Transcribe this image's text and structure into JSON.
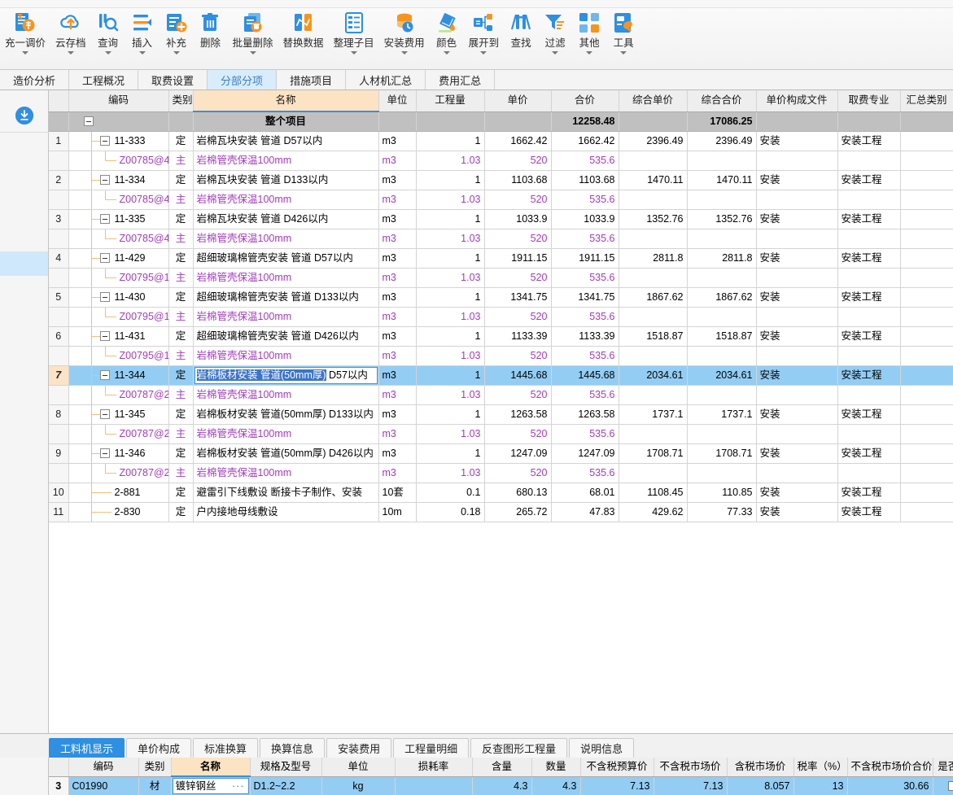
{
  "toolbar": {
    "items": [
      {
        "label": "充一调价",
        "icon": "price-adjust-icon",
        "caret": true
      },
      {
        "label": "云存档",
        "icon": "cloud-upload-icon",
        "caret": true
      },
      {
        "label": "查询",
        "icon": "query-search-icon",
        "caret": true
      },
      {
        "label": "插入",
        "icon": "insert-row-icon",
        "caret": true
      },
      {
        "label": "补充",
        "icon": "supplement-add-icon",
        "caret": true
      },
      {
        "label": "删除",
        "icon": "trash-delete-icon",
        "caret": false
      },
      {
        "label": "批量删除",
        "icon": "batch-delete-icon",
        "caret": true
      },
      {
        "label": "替换数据",
        "icon": "replace-data-icon",
        "caret": false
      },
      {
        "label": "整理子目",
        "icon": "organize-items-icon",
        "caret": true
      },
      {
        "label": "安装费用",
        "icon": "install-fee-icon",
        "caret": true
      },
      {
        "label": "颜色",
        "icon": "color-fill-icon",
        "caret": true
      },
      {
        "label": "展开到",
        "icon": "expand-to-icon",
        "caret": true
      },
      {
        "label": "查找",
        "icon": "find-binocular-icon",
        "caret": false
      },
      {
        "label": "过滤",
        "icon": "filter-funnel-icon",
        "caret": true
      },
      {
        "label": "其他",
        "icon": "other-grid-icon",
        "caret": true
      },
      {
        "label": "工具",
        "icon": "tools-icon",
        "caret": true
      }
    ]
  },
  "main_tabs": [
    {
      "label": "造价分析",
      "active": false
    },
    {
      "label": "工程概况",
      "active": false
    },
    {
      "label": "取费设置",
      "active": false
    },
    {
      "label": "分部分项",
      "active": true
    },
    {
      "label": "措施项目",
      "active": false
    },
    {
      "label": "人材机汇总",
      "active": false
    },
    {
      "label": "费用汇总",
      "active": false
    }
  ],
  "grid": {
    "headers": [
      "",
      "编码",
      "类别",
      "名称",
      "单位",
      "工程量",
      "单价",
      "合价",
      "综合单价",
      "综合合价",
      "单价构成文件",
      "取费专业",
      "汇总类别"
    ],
    "total_row": {
      "name": "整个项目",
      "heji": "12258.48",
      "zonghe_heji": "17086.25"
    },
    "rows": [
      {
        "no": "1",
        "code": "11-333",
        "kind": "定",
        "name": "岩棉瓦块安装  管道 D57以内",
        "unit": "m3",
        "qty": "1",
        "price": "1662.42",
        "amount": "1662.42",
        "zh_price": "2396.49",
        "zh_amount": "2396.49",
        "file": "安装",
        "prof": "安装工程",
        "cat": "",
        "type": "parent"
      },
      {
        "no": "",
        "code": "Z00785@4",
        "kind": "主",
        "name": "岩棉管壳保温100mm",
        "unit": "m3",
        "qty": "1.03",
        "price": "520",
        "amount": "535.6",
        "zh_price": "",
        "zh_amount": "",
        "file": "",
        "prof": "",
        "cat": "",
        "type": "child"
      },
      {
        "no": "2",
        "code": "11-334",
        "kind": "定",
        "name": "岩棉瓦块安装  管道 D133以内",
        "unit": "m3",
        "qty": "1",
        "price": "1103.68",
        "amount": "1103.68",
        "zh_price": "1470.11",
        "zh_amount": "1470.11",
        "file": "安装",
        "prof": "安装工程",
        "cat": "",
        "type": "parent"
      },
      {
        "no": "",
        "code": "Z00785@4",
        "kind": "主",
        "name": "岩棉管壳保温100mm",
        "unit": "m3",
        "qty": "1.03",
        "price": "520",
        "amount": "535.6",
        "zh_price": "",
        "zh_amount": "",
        "file": "",
        "prof": "",
        "cat": "",
        "type": "child"
      },
      {
        "no": "3",
        "code": "11-335",
        "kind": "定",
        "name": "岩棉瓦块安装  管道 D426以内",
        "unit": "m3",
        "qty": "1",
        "price": "1033.9",
        "amount": "1033.9",
        "zh_price": "1352.76",
        "zh_amount": "1352.76",
        "file": "安装",
        "prof": "安装工程",
        "cat": "",
        "type": "parent"
      },
      {
        "no": "",
        "code": "Z00785@4",
        "kind": "主",
        "name": "岩棉管壳保温100mm",
        "unit": "m3",
        "qty": "1.03",
        "price": "520",
        "amount": "535.6",
        "zh_price": "",
        "zh_amount": "",
        "file": "",
        "prof": "",
        "cat": "",
        "type": "child"
      },
      {
        "no": "4",
        "code": "11-429",
        "kind": "定",
        "name": "超细玻璃棉管壳安装  管道 D57以内",
        "unit": "m3",
        "qty": "1",
        "price": "1911.15",
        "amount": "1911.15",
        "zh_price": "2811.8",
        "zh_amount": "2811.8",
        "file": "安装",
        "prof": "安装工程",
        "cat": "",
        "type": "parent"
      },
      {
        "no": "",
        "code": "Z00795@1",
        "kind": "主",
        "name": "岩棉管壳保温100mm",
        "unit": "m3",
        "qty": "1.03",
        "price": "520",
        "amount": "535.6",
        "zh_price": "",
        "zh_amount": "",
        "file": "",
        "prof": "",
        "cat": "",
        "type": "child"
      },
      {
        "no": "5",
        "code": "11-430",
        "kind": "定",
        "name": "超细玻璃棉管壳安装  管道 D133以内",
        "unit": "m3",
        "qty": "1",
        "price": "1341.75",
        "amount": "1341.75",
        "zh_price": "1867.62",
        "zh_amount": "1867.62",
        "file": "安装",
        "prof": "安装工程",
        "cat": "",
        "type": "parent"
      },
      {
        "no": "",
        "code": "Z00795@1",
        "kind": "主",
        "name": "岩棉管壳保温100mm",
        "unit": "m3",
        "qty": "1.03",
        "price": "520",
        "amount": "535.6",
        "zh_price": "",
        "zh_amount": "",
        "file": "",
        "prof": "",
        "cat": "",
        "type": "child"
      },
      {
        "no": "6",
        "code": "11-431",
        "kind": "定",
        "name": "超细玻璃棉管壳安装  管道 D426以内",
        "unit": "m3",
        "qty": "1",
        "price": "1133.39",
        "amount": "1133.39",
        "zh_price": "1518.87",
        "zh_amount": "1518.87",
        "file": "安装",
        "prof": "安装工程",
        "cat": "",
        "type": "parent"
      },
      {
        "no": "",
        "code": "Z00795@1",
        "kind": "主",
        "name": "岩棉管壳保温100mm",
        "unit": "m3",
        "qty": "1.03",
        "price": "520",
        "amount": "535.6",
        "zh_price": "",
        "zh_amount": "",
        "file": "",
        "prof": "",
        "cat": "",
        "type": "child"
      },
      {
        "no": "7",
        "code": "11-344",
        "kind": "定",
        "name": "岩棉板材安装  管道(50mm厚) D57以内",
        "name_selected": "岩棉板材安装  管道(50mm厚)",
        "name_rest": " D57以内",
        "unit": "m3",
        "qty": "1",
        "price": "1445.68",
        "amount": "1445.68",
        "zh_price": "2034.61",
        "zh_amount": "2034.61",
        "file": "安装",
        "prof": "安装工程",
        "cat": "",
        "type": "parent",
        "selected": true,
        "editing": true
      },
      {
        "no": "",
        "code": "Z00787@2",
        "kind": "主",
        "name": "岩棉管壳保温100mm",
        "unit": "m3",
        "qty": "1.03",
        "price": "520",
        "amount": "535.6",
        "zh_price": "",
        "zh_amount": "",
        "file": "",
        "prof": "",
        "cat": "",
        "type": "child"
      },
      {
        "no": "8",
        "code": "11-345",
        "kind": "定",
        "name": "岩棉板材安装  管道(50mm厚) D133以内",
        "unit": "m3",
        "qty": "1",
        "price": "1263.58",
        "amount": "1263.58",
        "zh_price": "1737.1",
        "zh_amount": "1737.1",
        "file": "安装",
        "prof": "安装工程",
        "cat": "",
        "type": "parent"
      },
      {
        "no": "",
        "code": "Z00787@2",
        "kind": "主",
        "name": "岩棉管壳保温100mm",
        "unit": "m3",
        "qty": "1.03",
        "price": "520",
        "amount": "535.6",
        "zh_price": "",
        "zh_amount": "",
        "file": "",
        "prof": "",
        "cat": "",
        "type": "child"
      },
      {
        "no": "9",
        "code": "11-346",
        "kind": "定",
        "name": "岩棉板材安装  管道(50mm厚) D426以内",
        "unit": "m3",
        "qty": "1",
        "price": "1247.09",
        "amount": "1247.09",
        "zh_price": "1708.71",
        "zh_amount": "1708.71",
        "file": "安装",
        "prof": "安装工程",
        "cat": "",
        "type": "parent"
      },
      {
        "no": "",
        "code": "Z00787@2",
        "kind": "主",
        "name": "岩棉管壳保温100mm",
        "unit": "m3",
        "qty": "1.03",
        "price": "520",
        "amount": "535.6",
        "zh_price": "",
        "zh_amount": "",
        "file": "",
        "prof": "",
        "cat": "",
        "type": "child"
      },
      {
        "no": "10",
        "code": "2-881",
        "kind": "定",
        "name": "避雷引下线敷设  断接卡子制作、安装",
        "unit": "10套",
        "qty": "0.1",
        "price": "680.13",
        "amount": "68.01",
        "zh_price": "1108.45",
        "zh_amount": "110.85",
        "file": "安装",
        "prof": "安装工程",
        "cat": "",
        "type": "leaf"
      },
      {
        "no": "11",
        "code": "2-830",
        "kind": "定",
        "name": "户内接地母线敷设",
        "unit": "10m",
        "qty": "0.18",
        "price": "265.72",
        "amount": "47.83",
        "zh_price": "429.62",
        "zh_amount": "77.33",
        "file": "安装",
        "prof": "安装工程",
        "cat": "",
        "type": "leaf"
      }
    ]
  },
  "bottom": {
    "tabs": [
      {
        "label": "工料机显示",
        "active": true
      },
      {
        "label": "单价构成",
        "active": false
      },
      {
        "label": "标准换算",
        "active": false
      },
      {
        "label": "换算信息",
        "active": false
      },
      {
        "label": "安装费用",
        "active": false
      },
      {
        "label": "工程量明细",
        "active": false
      },
      {
        "label": "反查图形工程量",
        "active": false
      },
      {
        "label": "说明信息",
        "active": false
      }
    ],
    "headers": [
      "",
      "编码",
      "类别",
      "名称",
      "规格及型号",
      "单位",
      "损耗率",
      "含量",
      "数量",
      "不含税预算价",
      "不含税市场价",
      "含税市场价",
      "税率（%）",
      "不含税市场价合价",
      "是否暂"
    ],
    "row": {
      "no": "3",
      "code": "C01990",
      "kind": "材",
      "name": "镀锌钢丝",
      "spec": "D1.2~2.2",
      "unit": "kg",
      "loss": "",
      "content": "4.3",
      "qty": "4.3",
      "budget_price": "7.13",
      "market_price": "7.13",
      "taxed_price": "8.057",
      "tax_rate": "13",
      "market_total": "30.66",
      "is_temp": ""
    }
  },
  "colors": {
    "accent_blue": "#2f8fe0",
    "name_header": "#fce3c4",
    "sub_item_text": "#a23bbd",
    "selection": "#93cdf4",
    "tree_line": "#f5bd7a"
  }
}
